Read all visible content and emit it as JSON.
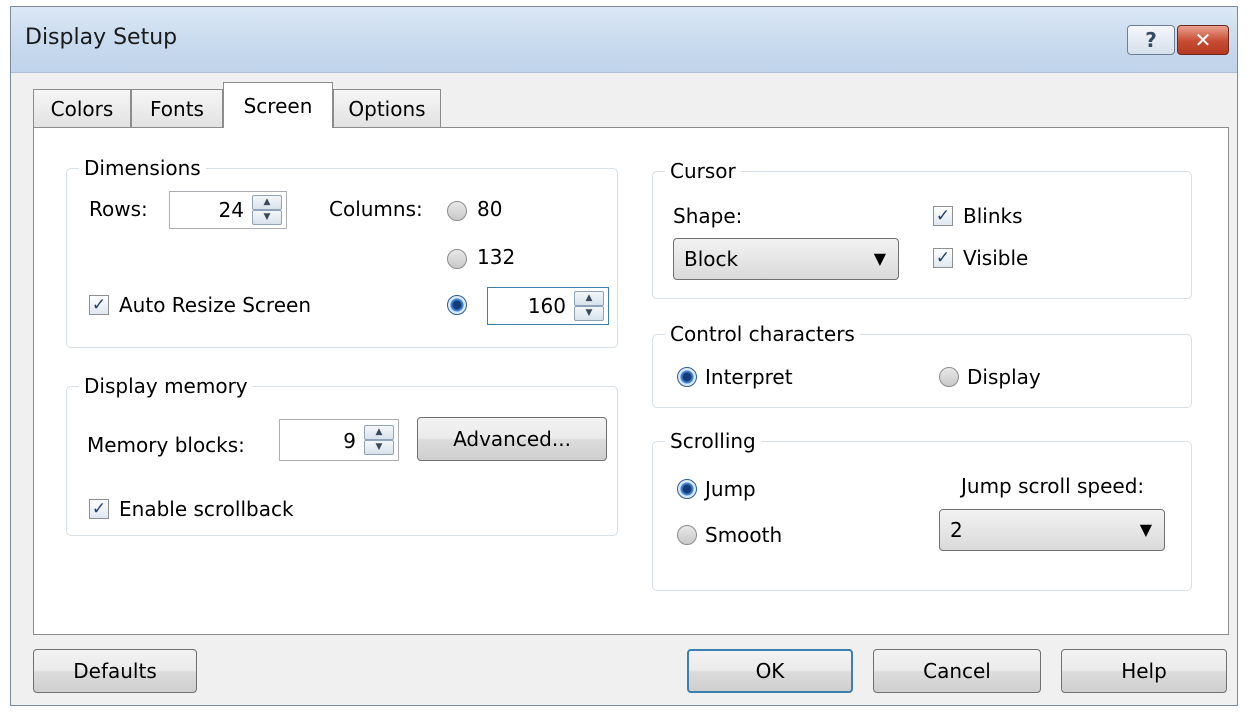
{
  "window": {
    "title": "Display Setup",
    "help_glyph": "?",
    "close_glyph": "✕"
  },
  "tabs": [
    {
      "label": "Colors"
    },
    {
      "label": "Fonts"
    },
    {
      "label": "Screen",
      "active": true
    },
    {
      "label": "Options"
    }
  ],
  "dimensions": {
    "legend": "Dimensions",
    "rows_label": "Rows:",
    "rows_value": "24",
    "columns_label": "Columns:",
    "col_80": "80",
    "col_132": "132",
    "col_custom_value": "160",
    "selected_column_option": "custom",
    "auto_resize_label": "Auto Resize Screen",
    "auto_resize_checked": true
  },
  "memory": {
    "legend": "Display memory",
    "blocks_label": "Memory blocks:",
    "blocks_value": "9",
    "advanced_label": "Advanced...",
    "scrollback_label": "Enable scrollback",
    "scrollback_checked": true
  },
  "cursor": {
    "legend": "Cursor",
    "shape_label": "Shape:",
    "shape_value": "Block",
    "blinks_label": "Blinks",
    "blinks_checked": true,
    "visible_label": "Visible",
    "visible_checked": true
  },
  "control": {
    "legend": "Control characters",
    "interpret_label": "Interpret",
    "display_label": "Display",
    "selected": "Interpret"
  },
  "scrolling": {
    "legend": "Scrolling",
    "jump_label": "Jump",
    "smooth_label": "Smooth",
    "selected": "Jump",
    "speed_label": "Jump scroll speed:",
    "speed_value": "2"
  },
  "buttons": {
    "defaults": "Defaults",
    "ok": "OK",
    "cancel": "Cancel",
    "help": "Help"
  },
  "glyphs": {
    "check": "✓",
    "dropdown": "▼",
    "spin_up": "▲",
    "spin_down": "▼"
  }
}
